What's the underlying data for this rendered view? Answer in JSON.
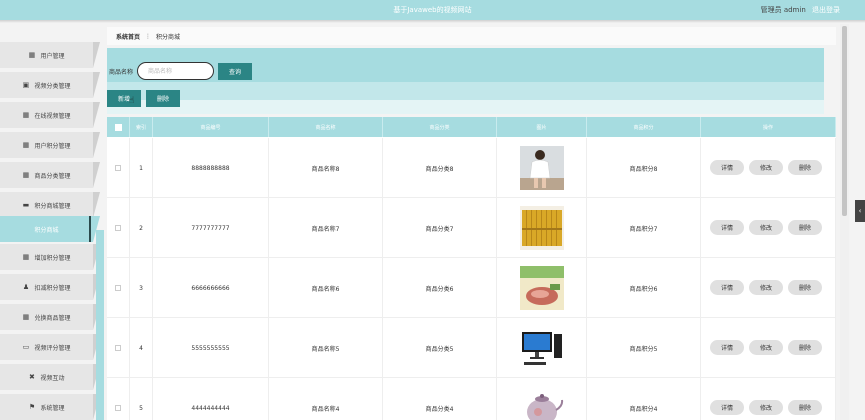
{
  "app": {
    "title": "基于Javaweb的视频网站",
    "user_label": "管理员 admin",
    "logout_label": "退出登录"
  },
  "sidebar": {
    "items": [
      {
        "label": "用户管理",
        "icon": "grid-icon"
      },
      {
        "label": "视频分类管理",
        "icon": "clipboard-icon"
      },
      {
        "label": "在线视频管理",
        "icon": "grid-icon"
      },
      {
        "label": "用户积分管理",
        "icon": "grid-icon"
      },
      {
        "label": "商品分类管理",
        "icon": "grid-icon"
      },
      {
        "label": "积分商城管理",
        "icon": "briefcase-icon"
      },
      {
        "label": "积分商城",
        "icon": "",
        "active": true
      },
      {
        "label": "增加积分管理",
        "icon": "grid-icon"
      },
      {
        "label": "扣减积分管理",
        "icon": "user-icon"
      },
      {
        "label": "兑换商品管理",
        "icon": "grid-icon"
      },
      {
        "label": "视频评分管理",
        "icon": "monitor-icon"
      },
      {
        "label": "视频互动",
        "icon": "ticket-icon"
      },
      {
        "label": "系统管理",
        "icon": "flag-icon"
      }
    ]
  },
  "breadcrumb": {
    "home": "系统首页",
    "separator": "⋮",
    "current": "积分商城"
  },
  "search": {
    "label": "商品名称",
    "placeholder": "商品名称",
    "value": "",
    "button_label": "查询"
  },
  "actions": {
    "add_label": "新增",
    "delete_label": "删除"
  },
  "table": {
    "headers": [
      "",
      "索引",
      "商品编号",
      "商品名称",
      "商品分类",
      "图片",
      "商品积分",
      "操作"
    ],
    "op_labels": {
      "detail": "详情",
      "edit": "修改",
      "delete": "删除"
    },
    "rows": [
      {
        "index": "1",
        "code": "8888888888",
        "name": "商品名称8",
        "category": "商品分类8",
        "points": "商品积分8",
        "image": "person-photo"
      },
      {
        "index": "2",
        "code": "7777777777",
        "name": "商品名称7",
        "category": "商品分类7",
        "points": "商品积分7",
        "image": "books-photo"
      },
      {
        "index": "3",
        "code": "6666666666",
        "name": "商品名称6",
        "category": "商品分类6",
        "points": "商品积分6",
        "image": "meat-package-photo"
      },
      {
        "index": "4",
        "code": "5555555555",
        "name": "商品名称5",
        "category": "商品分类5",
        "points": "商品积分5",
        "image": "computer-photo"
      },
      {
        "index": "5",
        "code": "4444444444",
        "name": "商品名称4",
        "category": "商品分类4",
        "points": "商品积分4",
        "image": "teapot-photo"
      }
    ]
  },
  "colors": {
    "accent": "#a6dce0",
    "button": "#2b8585"
  }
}
